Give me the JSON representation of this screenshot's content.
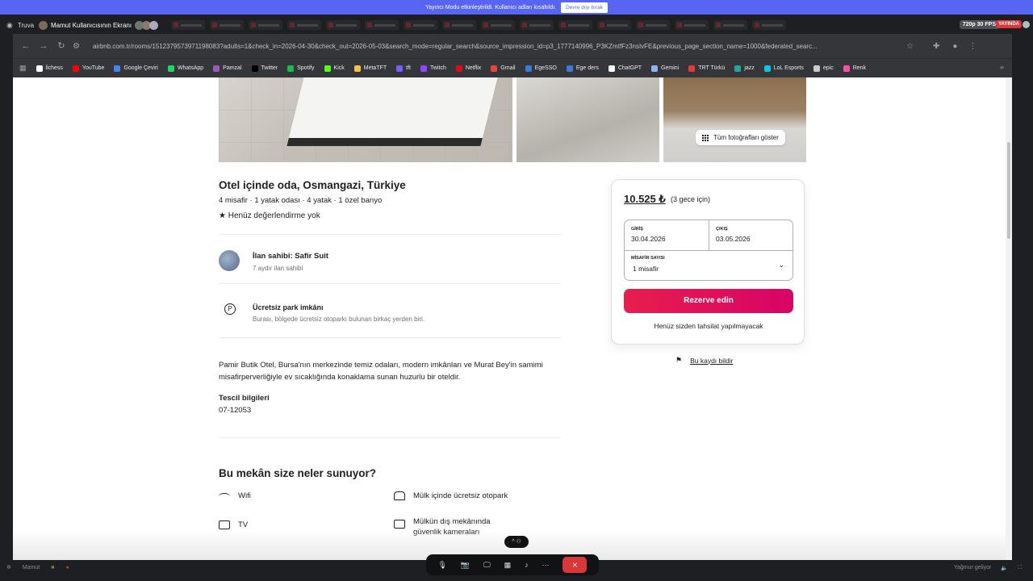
{
  "discord": {
    "banner_message": "Yayıncı Modu etkinleştirildi. Kullanıcı adları kısaltıldı.",
    "banner_button": "Devre dışı bırak",
    "server_name": "Truva",
    "stream_title": "Mamut Kullanıcısının Ekranı",
    "fps_badge": "720p 30 FPS",
    "live_badge": "YAYINDA",
    "up_pill": "^ ⚇",
    "taskbar_user": "Mamut",
    "weather": "Yağmur geliyor",
    "controls": {
      "mic": "🎙",
      "camera": "📷",
      "screen": "🖵",
      "activities": "▦",
      "soundboard": "♪",
      "more": "···",
      "end_call": "⨯"
    }
  },
  "browser": {
    "url": "airbnb.com.tr/rooms/1512379573971198083?adults=1&check_in=2026-04-30&check_out=2026-05-03&search_mode=regular_search&source_impression_id=p3_1777140996_P3KZmtfFz3nsIvFE&previous_page_section_name=1000&federated_searc...",
    "bookmarks": [
      {
        "label": "lichess",
        "color": "#ffffff"
      },
      {
        "label": "YouTube",
        "color": "#ff0000"
      },
      {
        "label": "Google Çeviri",
        "color": "#4285f4"
      },
      {
        "label": "WhatsApp",
        "color": "#25d366"
      },
      {
        "label": "Pamzal",
        "color": "#9b59b6"
      },
      {
        "label": "Twitter",
        "color": "#000000"
      },
      {
        "label": "Spotify",
        "color": "#1db954"
      },
      {
        "label": "Kick",
        "color": "#53fc18"
      },
      {
        "label": "MetaTFT",
        "color": "#f5c242"
      },
      {
        "label": "tft",
        "color": "#7c5cff"
      },
      {
        "label": "Twitch",
        "color": "#9146ff"
      },
      {
        "label": "Netflix",
        "color": "#e50914"
      },
      {
        "label": "Gmail",
        "color": "#ea4335"
      },
      {
        "label": "EgeSSO",
        "color": "#3a7bd5"
      },
      {
        "label": "Ege ders",
        "color": "#3a7bd5"
      },
      {
        "label": "ChatGPT",
        "color": "#ffffff"
      },
      {
        "label": "Gemini",
        "color": "#8ab4f8"
      },
      {
        "label": "TRT Türkü",
        "color": "#e53935"
      },
      {
        "label": "jazz",
        "color": "#26a69a"
      },
      {
        "label": "LoL Esports",
        "color": "#0bc4e3"
      },
      {
        "label": "epic",
        "color": "#cccccc"
      },
      {
        "label": "Renk",
        "color": "#ff4fa3"
      }
    ]
  },
  "listing": {
    "show_all_photos": "Tüm fotoğrafları göster",
    "title": "Otel içinde oda, Osmangazi, Türkiye",
    "subtitle": "4 misafir · 1 yatak odası · 4 yatak · 1 özel banyo",
    "rating": "★ Henüz değerlendirme yok",
    "host_name": "İlan sahibi: Safir Suit",
    "host_since": "7 aydır ilan sahibi",
    "highlight_title": "Ücretsiz park imkânı",
    "highlight_sub": "Burası, bölgede ücretsiz otoparkı bulunan birkaç yerden biri.",
    "description": "Pamir Butik Otel, Bursa'nın merkezinde temiz odaları, modern imkânları ve Murat Bey'in samimi misafirperverliğiyle ev sıcaklığında konaklama sunan huzurlu bir oteldir.",
    "registration_title": "Tescil bilgileri",
    "registration_number": "07-12053",
    "offers_title": "Bu mekân size neler sunuyor?",
    "amenities": [
      "Wifi",
      "Mülk içinde ücretsiz otopark",
      "TV",
      "Mülkün dış mekânında güvenlik kameraları"
    ]
  },
  "booking": {
    "price": "10.525 ₺",
    "price_sub": "(3 gece için)",
    "checkin_label": "GİRİŞ",
    "checkin_value": "30.04.2026",
    "checkout_label": "ÇIKIŞ",
    "checkout_value": "03.05.2026",
    "guests_label": "MİSAFİR SAYISI",
    "guests_value": "1 misafir",
    "reserve_button": "Rezerve edin",
    "no_charge": "Henüz sizden tahsilat yapılmayacak",
    "report": "Bu kaydı bildir"
  }
}
